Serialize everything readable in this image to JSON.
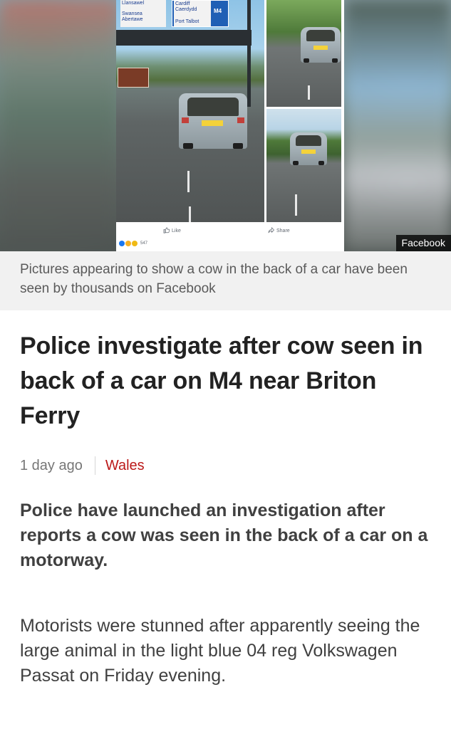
{
  "image": {
    "credit_badge": "Facebook",
    "post": {
      "like_label": "Like",
      "share_label": "Share",
      "reaction_count": "547",
      "road_sign": {
        "left_lines": [
          "Llansawel",
          "Swansea",
          "Abertawe"
        ],
        "right_lines": [
          "Cardiff",
          "Caerdydd",
          "Port Talbot"
        ],
        "motorway": "M4"
      }
    }
  },
  "caption": "Pictures appearing to show a cow in the back of a car have been seen by thousands on Facebook",
  "article": {
    "headline": "Police investigate after cow seen in back of a car on M4 near Briton Ferry",
    "timestamp": "1 day ago",
    "section": "Wales",
    "intro": "Police have launched an investigation after reports a cow was seen in the back of a car on a motorway.",
    "body": "Motorists were stunned after apparently seeing the large animal in the light blue 04 reg Volkswagen Passat on Friday evening."
  },
  "colors": {
    "section_link": "#bb1919",
    "caption_bg": "#f1f1f1",
    "headline": "#222222",
    "body": "#404040"
  },
  "icons": {
    "like": "thumbs-up-icon",
    "share": "share-arrow-icon"
  }
}
